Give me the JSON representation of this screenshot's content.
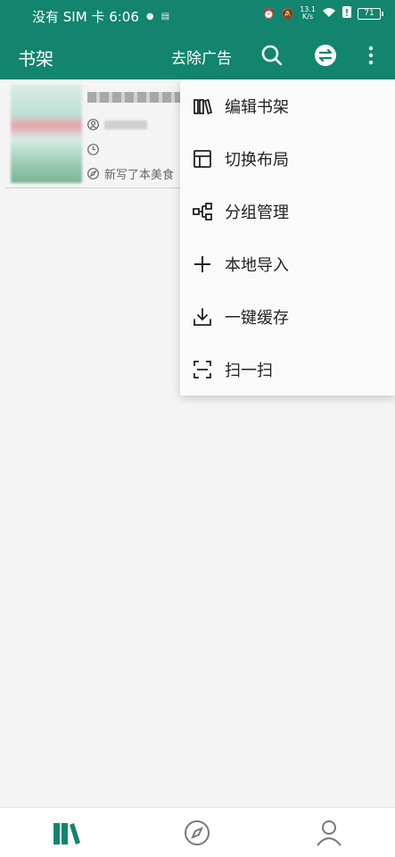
{
  "status": {
    "carrier_time": "没有 SIM 卡 6:06",
    "net_speed_value": "13.1",
    "net_speed_unit": "K/s",
    "battery": "71"
  },
  "toolbar": {
    "title": "书架",
    "remove_ads": "去除广告"
  },
  "book": {
    "latest_chapter": "新写了本美食"
  },
  "menu": {
    "items": [
      {
        "label": "编辑书架",
        "icon": "books-icon"
      },
      {
        "label": "切换布局",
        "icon": "layout-icon"
      },
      {
        "label": "分组管理",
        "icon": "group-icon"
      },
      {
        "label": "本地导入",
        "icon": "plus-icon"
      },
      {
        "label": "一键缓存",
        "icon": "download-icon"
      },
      {
        "label": "扫一扫",
        "icon": "scan-icon"
      }
    ]
  },
  "colors": {
    "primary": "#13846d",
    "menu_bg": "#fafafa",
    "page_bg": "#f4f4f4"
  }
}
